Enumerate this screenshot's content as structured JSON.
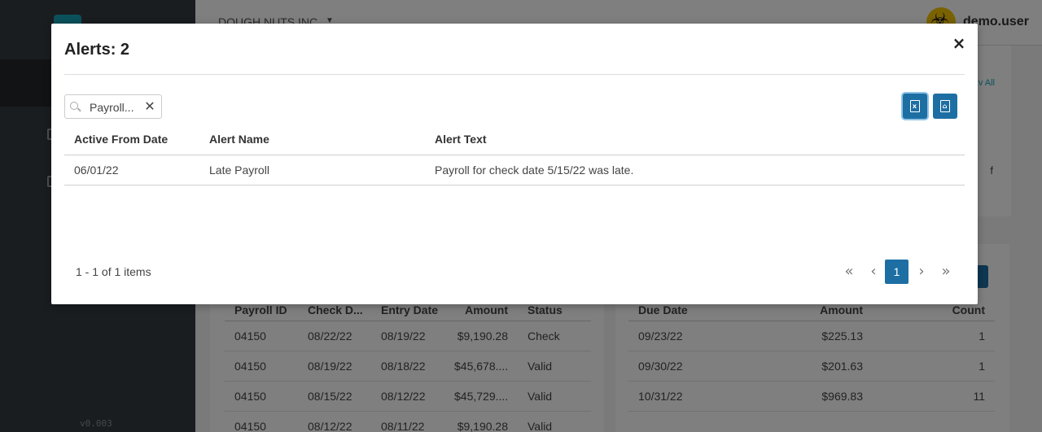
{
  "app": {
    "company": "DOUGH NUTS INC.",
    "user_name": "demo.user",
    "version": "v0.003",
    "view_all_label": "v All",
    "truncated_text": "f"
  },
  "background_payroll_table": {
    "columns": [
      "Payroll ID",
      "Check D...",
      "Entry Date",
      "Amount",
      "Status"
    ],
    "rows": [
      [
        "04150",
        "08/22/22",
        "08/19/22",
        "$9,190.28",
        "Check"
      ],
      [
        "04150",
        "08/19/22",
        "08/18/22",
        "$45,678....",
        "Valid"
      ],
      [
        "04150",
        "08/15/22",
        "08/12/22",
        "$45,729....",
        "Valid"
      ],
      [
        "04150",
        "08/12/22",
        "08/11/22",
        "$9,190.28",
        "Valid"
      ]
    ]
  },
  "background_due_table": {
    "columns": [
      "Due Date",
      "Amount",
      "Count"
    ],
    "rows": [
      [
        "09/23/22",
        "$225.13",
        "1"
      ],
      [
        "09/30/22",
        "$201.63",
        "1"
      ],
      [
        "10/31/22",
        "$969.83",
        "11"
      ]
    ]
  },
  "modal": {
    "title": "Alerts: 2",
    "close_label": "×",
    "search": {
      "value": "Payroll...",
      "clear_label": "✕"
    },
    "export_buttons": [
      {
        "name": "excel-icon",
        "glyph": "x"
      },
      {
        "name": "pdf-icon",
        "glyph": "⌂"
      }
    ],
    "table": {
      "columns": [
        "Active From Date",
        "Alert Name",
        "Alert Text"
      ],
      "rows": [
        [
          "06/01/22",
          "Late Payroll",
          "Payroll for check date 5/15/22 was late."
        ]
      ]
    },
    "pager": {
      "info": "1 - 1 of 1 items",
      "first": "«",
      "prev": "‹",
      "current": "1",
      "next": "›",
      "last": "»"
    }
  },
  "colors": {
    "sidebar": "#343a40",
    "primary": "#1d6fa3",
    "accent": "#17a2b8",
    "overlay": "rgba(0,0,0,0.5)"
  }
}
